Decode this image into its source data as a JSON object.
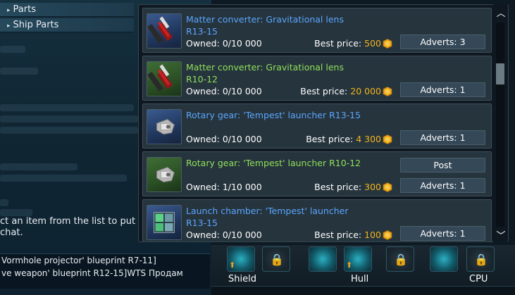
{
  "categories": [
    {
      "label": "Parts"
    },
    {
      "label": "Ship Parts"
    }
  ],
  "hint": "ct an item from the list to put chat.",
  "chat": [
    "Vormhole projector' blueprint R7-11]",
    "ve weapon' blueprint R12-15]WTS Продам"
  ],
  "bottom_labels": {
    "shield": "Shield",
    "hull": "Hull",
    "cpu": "CPU"
  },
  "market": {
    "owned_label": "Owned:",
    "price_label": "Best price:",
    "adverts_label": "Adverts:",
    "post_label": "Post",
    "items": [
      {
        "name": "Matter converter: Gravitational lens",
        "grade": "R13-15",
        "quality": "blue",
        "icon": "lens-icon",
        "owned": "0/10 000",
        "price": "500",
        "adverts": "3",
        "post": false
      },
      {
        "name": "Matter converter: Gravitational lens",
        "grade": "R10-12",
        "quality": "green",
        "icon": "lens-icon",
        "owned": "0/10 000",
        "price": "20 000",
        "adverts": "1",
        "post": false
      },
      {
        "name": "Rotary gear: 'Tempest' launcher R13-15",
        "grade": "",
        "quality": "blue",
        "icon": "gear-icon",
        "owned": "0/10 000",
        "price": "4 300",
        "adverts": "1",
        "post": false
      },
      {
        "name": "Rotary gear: 'Tempest' launcher R10-12",
        "grade": "",
        "quality": "green",
        "icon": "gear-icon",
        "owned": "1/10 000",
        "price": "300",
        "adverts": "1",
        "post": true
      },
      {
        "name": "Launch chamber: 'Tempest' launcher",
        "grade": "R13-15",
        "quality": "blue",
        "icon": "chamber-icon",
        "owned": "0/10 000",
        "price": "100",
        "adverts": "1",
        "post": false
      }
    ]
  },
  "colors": {
    "blue_quality": "#5aa6ff",
    "green_quality": "#8fe05a",
    "price": "#f2b51c"
  }
}
